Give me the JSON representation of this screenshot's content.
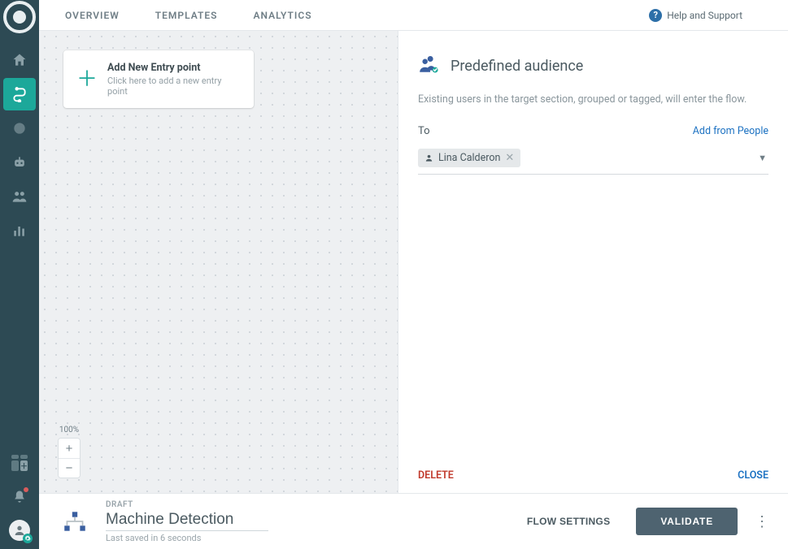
{
  "tabs": {
    "overview": "OVERVIEW",
    "templates": "TEMPLATES",
    "analytics": "ANALYTICS"
  },
  "help_label": "Help and Support",
  "entry_card": {
    "title": "Add New Entry point",
    "subtitle": "Click here to add a new entry point"
  },
  "zoom": {
    "level": "100%"
  },
  "panel": {
    "title": "Predefined audience",
    "description": "Existing users in the target section, grouped or tagged, will enter the flow.",
    "to_label": "To",
    "add_link": "Add from People",
    "chip_name": "Lina Calderon",
    "delete": "DELETE",
    "close": "CLOSE"
  },
  "footer": {
    "draft": "DRAFT",
    "title": "Machine Detection",
    "saved": "Last saved in 6 seconds",
    "flow_settings": "FLOW SETTINGS",
    "validate": "VALIDATE"
  }
}
